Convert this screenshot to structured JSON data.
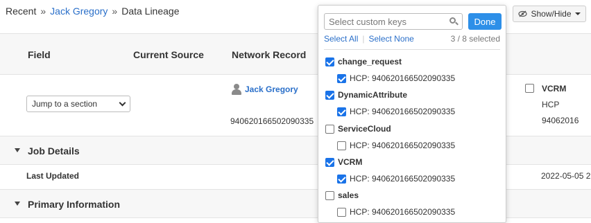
{
  "breadcrumb": {
    "items": [
      "Recent",
      "Jack Gregory",
      "Data Lineage"
    ],
    "separator": "»"
  },
  "show_hide": {
    "label": "Show/Hide",
    "icon": "eye-slash-icon"
  },
  "table": {
    "headers": [
      "Field",
      "Current Source",
      "Network Record"
    ],
    "jump_select": {
      "value": "Jump to a section"
    },
    "network_record": {
      "name": "Jack Gregory",
      "id": "940620166502090335"
    },
    "vcrm_column": {
      "title": "VCRM",
      "type": "HCP",
      "id_fragment": "94062016"
    },
    "sections": [
      {
        "label": "Job Details"
      },
      {
        "label": "Primary Information"
      }
    ],
    "row": {
      "label": "Last Updated",
      "value": "2022-05-05 2"
    }
  },
  "dropdown": {
    "search_placeholder": "Select custom keys",
    "done_label": "Done",
    "select_all": "Select All",
    "select_none": "Select None",
    "count": "3 / 8 selected",
    "options": [
      {
        "label": "change_request",
        "checked": true,
        "child": {
          "label": "HCP: 940620166502090335",
          "checked": true
        }
      },
      {
        "label": "DynamicAttribute",
        "checked": true,
        "child": {
          "label": "HCP: 940620166502090335",
          "checked": true
        }
      },
      {
        "label": "ServiceCloud",
        "checked": false,
        "child": {
          "label": "HCP: 940620166502090335",
          "checked": false
        }
      },
      {
        "label": "VCRM",
        "checked": true,
        "child": {
          "label": "HCP: 940620166502090335",
          "checked": true
        }
      },
      {
        "label": "sales",
        "checked": false,
        "child": {
          "label": "HCP: 940620166502090335",
          "checked": false
        }
      }
    ]
  },
  "colors": {
    "link": "#2a6fc9",
    "primary_button": "#2d8fe8",
    "checkbox_on": "#1a73e8"
  }
}
